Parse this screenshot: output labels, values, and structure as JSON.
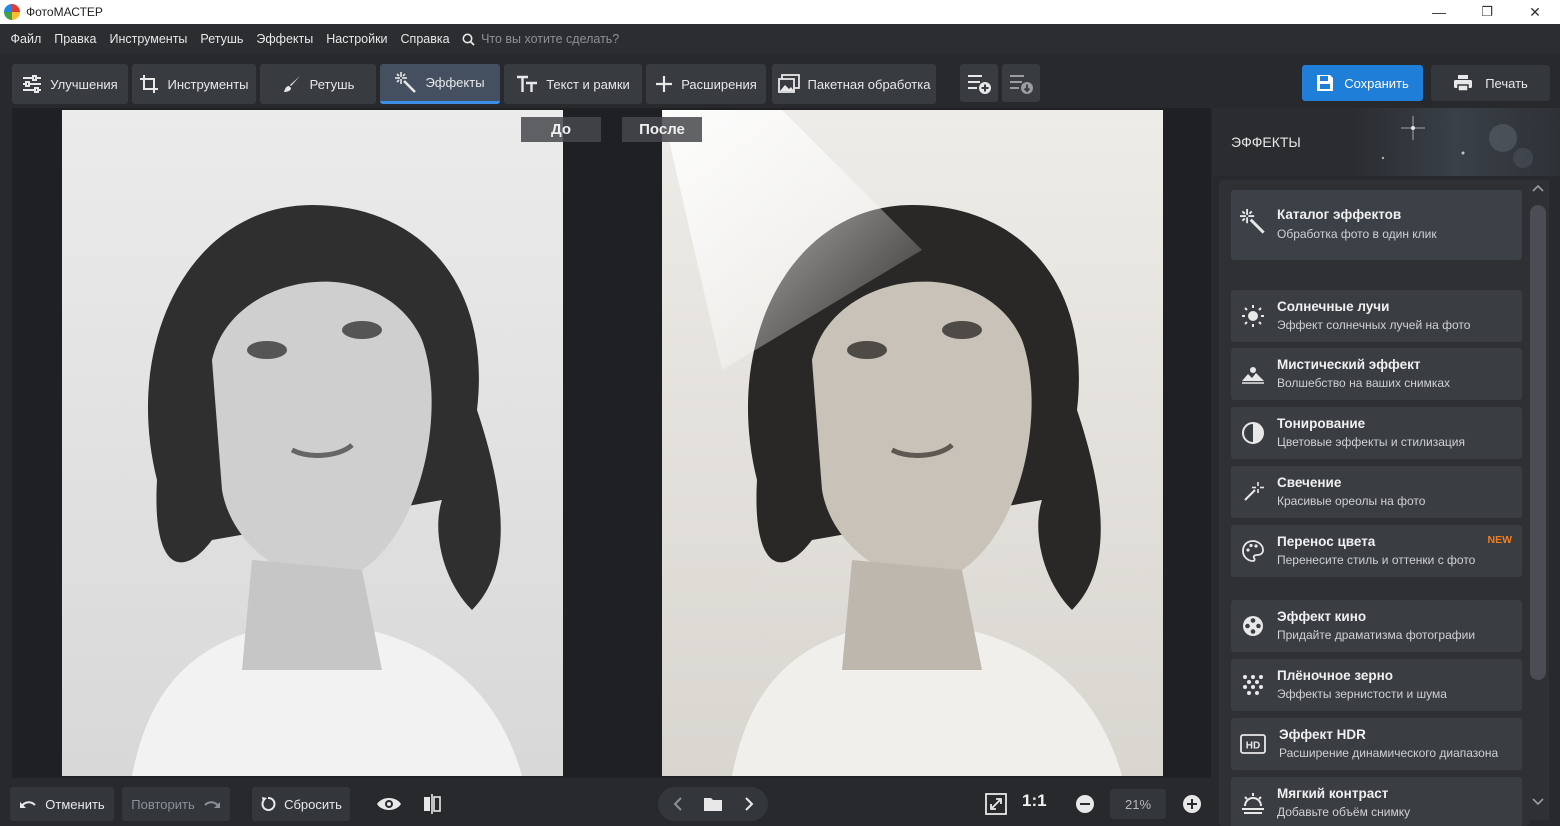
{
  "window": {
    "title": "ФотоМАСТЕР",
    "minimize": "—",
    "restore": "❐",
    "close": "✕"
  },
  "menu": {
    "items": [
      "Файл",
      "Правка",
      "Инструменты",
      "Ретушь",
      "Эффекты",
      "Настройки",
      "Справка"
    ],
    "search_placeholder": "Что вы хотите сделать?"
  },
  "toolbar": {
    "tabs": [
      {
        "label": "Улучшения",
        "icon": "sliders-icon"
      },
      {
        "label": "Инструменты",
        "icon": "crop-icon"
      },
      {
        "label": "Ретушь",
        "icon": "brush-icon"
      },
      {
        "label": "Эффекты",
        "icon": "magic-wand-icon",
        "active": true
      },
      {
        "label": "Текст и рамки",
        "icon": "text-icon"
      },
      {
        "label": "Расширения",
        "icon": "plus-icon"
      },
      {
        "label": "Пакетная обработка",
        "icon": "images-icon"
      }
    ],
    "save_label": "Сохранить",
    "print_label": "Печать"
  },
  "compare": {
    "before_label": "До",
    "after_label": "После"
  },
  "bottombar": {
    "undo_label": "Отменить",
    "redo_label": "Повторить",
    "reset_label": "Сбросить",
    "one_to_one": "1:1",
    "zoom": "21%"
  },
  "effects_panel": {
    "title": "ЭФФЕКТЫ",
    "catalog": {
      "title": "Каталог эффектов",
      "desc": "Обработка фото в один клик",
      "icon": "magic-wand-icon"
    },
    "items": [
      {
        "title": "Солнечные лучи",
        "desc": "Эффект солнечных лучей на фото",
        "icon": "sun-icon"
      },
      {
        "title": "Мистический эффект",
        "desc": "Волшебство на ваших снимках",
        "icon": "landscape-icon"
      },
      {
        "title": "Тонирование",
        "desc": "Цветовые эффекты и стилизация",
        "icon": "half-circle-icon"
      },
      {
        "title": "Свечение",
        "desc": "Красивые ореолы на фото",
        "icon": "glow-icon"
      },
      {
        "title": "Перенос цвета",
        "desc": "Перенесите стиль и оттенки с фото",
        "icon": "palette-icon",
        "badge": "NEW"
      },
      {
        "title": "Эффект кино",
        "desc": "Придайте драматизма фотографии",
        "icon": "film-reel-icon"
      },
      {
        "title": "Плёночное зерно",
        "desc": "Эффекты зернистости и шума",
        "icon": "grain-icon"
      },
      {
        "title": "Эффект HDR",
        "desc": "Расширение динамического диапазона",
        "icon": "hdr-icon"
      },
      {
        "title": "Мягкий контраст",
        "desc": "Добавьте объём снимку",
        "icon": "contrast-icon"
      }
    ]
  },
  "colors": {
    "accent": "#1e7ed8",
    "background": "#27292d",
    "new_badge": "#f07e20"
  }
}
